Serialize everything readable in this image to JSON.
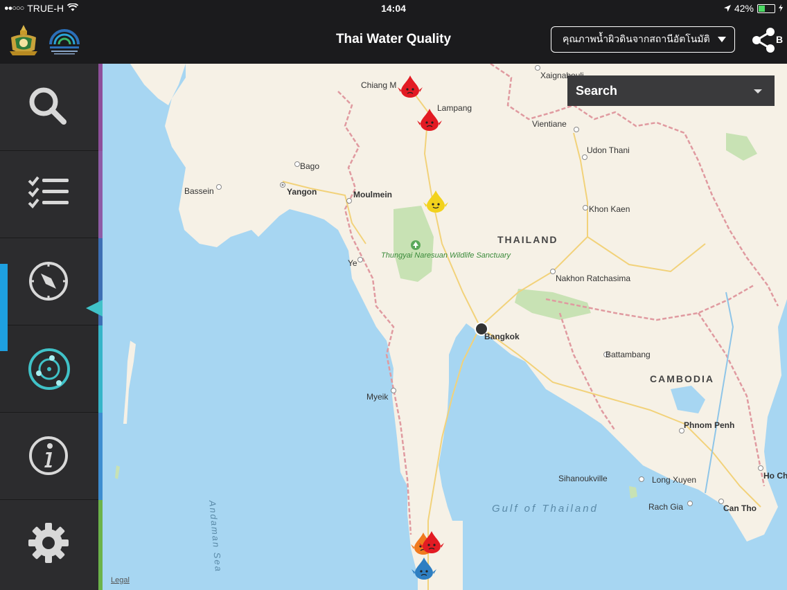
{
  "status_bar": {
    "carrier": "TRUE-H",
    "signal": "●●○○○",
    "time": "14:04",
    "battery": "42%",
    "battery_level": 0.42
  },
  "header": {
    "title": "Thai Water Quality",
    "station_type_selected": "คุณภาพน้ำผิวดินจากสถานีอัตโนมัติ",
    "share_label": "B"
  },
  "sidebar": {
    "items": [
      {
        "name": "search-icon"
      },
      {
        "name": "checklist-icon"
      },
      {
        "name": "compass-icon"
      },
      {
        "name": "radar-icon",
        "active": true
      },
      {
        "name": "info-icon"
      },
      {
        "name": "gear-icon"
      }
    ],
    "strip_colors": [
      "#8e4f9a",
      "#8e5ba6",
      "#3d6fb4",
      "#35b5c8",
      "#3d8dd0",
      "#6cb34a"
    ],
    "active_color": "#1ea0e0"
  },
  "map": {
    "search_label": "Search",
    "legal_label": "Legal",
    "labels": {
      "chiang_mai": "Chiang M",
      "lampang": "Lampang",
      "xaignabouli": "Xaignabouli",
      "vientiane": "Vientiane",
      "udon_thani": "Udon Thani",
      "bago": "Bago",
      "bassein": "Bassein",
      "yangon": "Yangon",
      "moulmein": "Moulmein",
      "khon_kaen": "Khon Kaen",
      "thailand": "THAILAND",
      "thungyai": "Thungyai Naresuan Wildlife Sanctuary",
      "ye": "Ye",
      "nakhon_ratchasima": "Nakhon Ratchasima",
      "bangkok": "Bangkok",
      "battambang": "Battambang",
      "cambodia": "CAMBODIA",
      "myeik": "Myeik",
      "phnom_penh": "Phnom Penh",
      "andaman_sea": "Andaman Sea",
      "sihanoukville": "Sihanoukville",
      "long_xuyen": "Long Xuyen",
      "ho_chi": "Ho Ch",
      "rach_gia": "Rach Gia",
      "can_tho": "Can Tho",
      "gulf_of_thailand": "Gulf of Thailand"
    },
    "markers": [
      {
        "name": "water-drop-red-chiang-mai",
        "color": "#e21b23"
      },
      {
        "name": "water-drop-red-lampang",
        "color": "#e21b23"
      },
      {
        "name": "water-drop-yellow",
        "color": "#f2d21c"
      },
      {
        "name": "water-drop-orange",
        "color": "#f07a1e"
      },
      {
        "name": "water-drop-red-south",
        "color": "#e21b23"
      },
      {
        "name": "water-drop-blue",
        "color": "#2e7fc2"
      }
    ],
    "colors": {
      "sea": "#a7d6f2",
      "land": "#f6f1e6",
      "park": "#c8e2b4",
      "border": "#e09aa0",
      "road": "#f2d27a"
    }
  }
}
